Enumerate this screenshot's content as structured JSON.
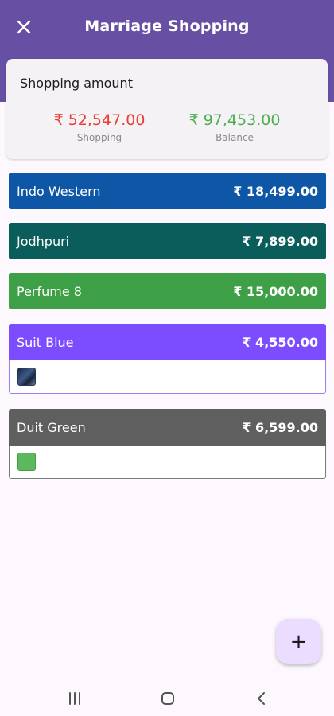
{
  "appbar": {
    "title": "Marriage Shopping",
    "close_icon": "close-icon"
  },
  "summary": {
    "label": "Shopping amount",
    "shopping_amount": "₹ 52,547.00",
    "shopping_label": "Shopping",
    "balance_amount": "₹ 97,453.00",
    "balance_label": "Balance"
  },
  "items": [
    {
      "name": "Indo Western",
      "price": "₹ 18,499.00",
      "color": "#0d57a6"
    },
    {
      "name": "Jodhpuri",
      "price": "₹ 7,899.00",
      "color": "#0a5d5a"
    },
    {
      "name": "Perfume 8",
      "price": "₹ 15,000.00",
      "color": "#3d9f46"
    },
    {
      "name": "Suit Blue",
      "price": "₹ 4,550.00",
      "color": "#7c4dff"
    },
    {
      "name": "Duit Green",
      "price": "₹ 6,599.00",
      "color": "#5f5f5f"
    }
  ],
  "fab": {
    "label": "+"
  },
  "nav": {
    "recents_icon": "recents-icon",
    "home_icon": "home-icon",
    "back_icon": "back-icon"
  }
}
